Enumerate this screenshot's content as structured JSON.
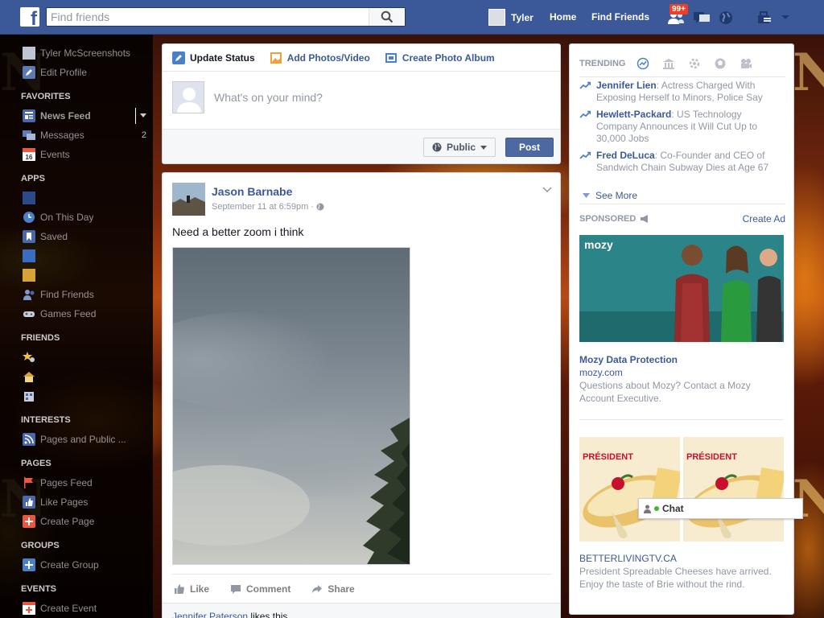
{
  "topbar": {
    "search_placeholder": "Find friends",
    "user_name": "Tyler",
    "home_label": "Home",
    "find_friends_label": "Find Friends",
    "friend_requests_badge": "99+"
  },
  "leftnav": {
    "profile": {
      "name": "Tyler McScreenshots",
      "edit": "Edit Profile"
    },
    "favorites": {
      "heading": "FAVORITES",
      "items": [
        {
          "label": "News Feed",
          "count": ""
        },
        {
          "label": "Messages",
          "count": "2"
        },
        {
          "label": "Events",
          "count": ""
        }
      ]
    },
    "apps": {
      "heading": "APPS",
      "items": [
        {
          "label": ""
        },
        {
          "label": "On This Day"
        },
        {
          "label": "Saved"
        },
        {
          "label": ""
        },
        {
          "label": ""
        },
        {
          "label": "Find Friends"
        },
        {
          "label": "Games Feed"
        }
      ]
    },
    "friends": {
      "heading": "FRIENDS",
      "items": [
        {
          "label": ""
        },
        {
          "label": ""
        },
        {
          "label": ""
        }
      ]
    },
    "interests": {
      "heading": "INTERESTS",
      "items": [
        {
          "label": "Pages and Public ..."
        }
      ]
    },
    "pages": {
      "heading": "PAGES",
      "items": [
        {
          "label": "Pages Feed"
        },
        {
          "label": "Like Pages"
        },
        {
          "label": "Create Page"
        }
      ]
    },
    "groups": {
      "heading": "GROUPS",
      "items": [
        {
          "label": "Create Group"
        }
      ]
    },
    "events": {
      "heading": "EVENTS",
      "items": [
        {
          "label": "Create Event"
        }
      ]
    },
    "colors": {
      "events_icon": "#e9573f",
      "accent": "#3b5998"
    }
  },
  "composer": {
    "tabs": [
      "Update Status",
      "Add Photos/Video",
      "Create Photo Album"
    ],
    "placeholder": "What's on your mind?",
    "privacy": "Public",
    "post_button": "Post"
  },
  "post": {
    "author": "Jason Barnabe",
    "timestamp": "September 11 at 6:59pm",
    "text": "Need a better zoom i think",
    "actions": [
      "Like",
      "Comment",
      "Share"
    ],
    "liked_by": "Jennifer Paterson",
    "likes_suffix": " likes this."
  },
  "trending": {
    "heading": "TRENDING",
    "items": [
      {
        "name": "Jennifer Lien",
        "desc": ": Actress Charged With Exposing Herself to Minors, Police Say"
      },
      {
        "name": "Hewlett-Packard",
        "desc": ": US Technology Company Announces it Will Cut Up to 30,000 Jobs"
      },
      {
        "name": "Fred DeLuca",
        "desc": ": Co-Founder and CEO of Sandwich Chain Subway Dies at Age 67"
      }
    ],
    "see_more": "See More"
  },
  "sponsored": {
    "heading": "SPONSORED",
    "create_ad": "Create Ad",
    "ads": [
      {
        "brand": "mozy",
        "title": "Mozy Data Protection",
        "url": "mozy.com",
        "desc": "Questions about Mozy? Contact a Mozy Account Executive."
      },
      {
        "brand": "PRÉSIDENT",
        "title": "",
        "url": "BETTERLIVINGTV.CA",
        "desc": "President Spreadable Cheeses have arrived. Enjoy the taste of Brie without the rind."
      }
    ]
  },
  "chat": {
    "label": "Chat"
  }
}
